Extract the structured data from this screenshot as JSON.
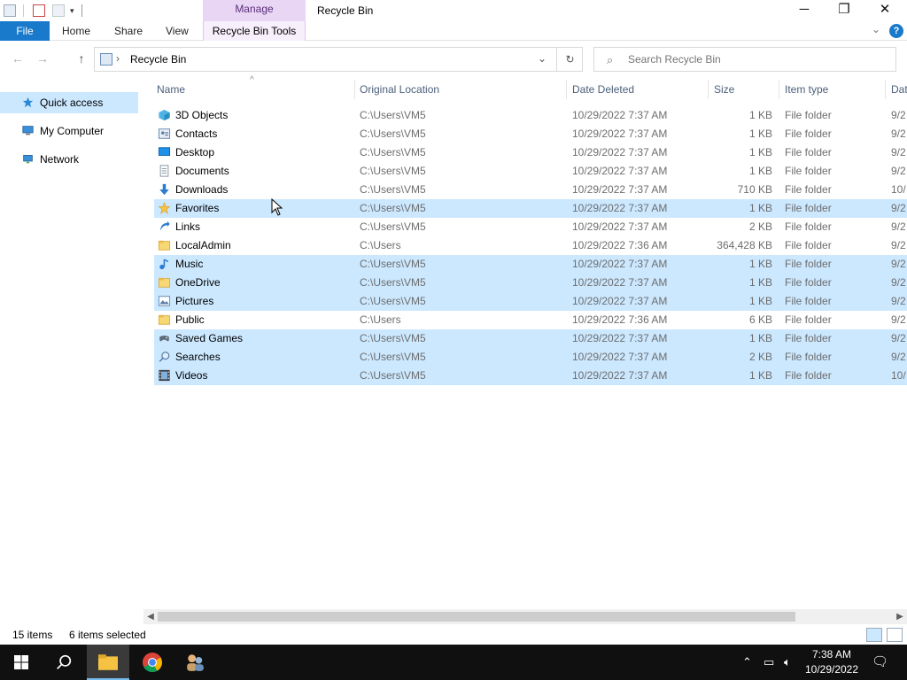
{
  "window": {
    "title": "Recycle Bin",
    "context_tab": "Manage",
    "minimize_glyph": "─",
    "maximize_glyph": "❐",
    "close_glyph": "✕"
  },
  "ribbon": {
    "file": "File",
    "tabs": [
      "Home",
      "Share",
      "View"
    ],
    "context_tab_label": "Recycle Bin Tools"
  },
  "address": {
    "path": "Recycle Bin",
    "search_placeholder": "Search Recycle Bin"
  },
  "nav": {
    "items": [
      {
        "label": "Quick access",
        "icon": "star-icon",
        "selected": true
      },
      {
        "label": "My Computer",
        "icon": "computer-icon",
        "selected": false
      },
      {
        "label": "Network",
        "icon": "network-icon",
        "selected": false
      }
    ]
  },
  "columns": [
    "Name",
    "Original Location",
    "Date Deleted",
    "Size",
    "Item type",
    "Dat"
  ],
  "rows": [
    {
      "name": "3D Objects",
      "location": "C:\\Users\\VM5",
      "date": "10/29/2022 7:37 AM",
      "size": "1 KB",
      "type": "File folder",
      "more": "9/2",
      "selected": false,
      "icon": "cube-icon"
    },
    {
      "name": "Contacts",
      "location": "C:\\Users\\VM5",
      "date": "10/29/2022 7:37 AM",
      "size": "1 KB",
      "type": "File folder",
      "more": "9/2",
      "selected": false,
      "icon": "contacts-icon"
    },
    {
      "name": "Desktop",
      "location": "C:\\Users\\VM5",
      "date": "10/29/2022 7:37 AM",
      "size": "1 KB",
      "type": "File folder",
      "more": "9/2",
      "selected": false,
      "icon": "desktop-icon"
    },
    {
      "name": "Documents",
      "location": "C:\\Users\\VM5",
      "date": "10/29/2022 7:37 AM",
      "size": "1 KB",
      "type": "File folder",
      "more": "9/2",
      "selected": false,
      "icon": "document-icon"
    },
    {
      "name": "Downloads",
      "location": "C:\\Users\\VM5",
      "date": "10/29/2022 7:37 AM",
      "size": "710 KB",
      "type": "File folder",
      "more": "10/",
      "selected": false,
      "icon": "download-icon"
    },
    {
      "name": "Favorites",
      "location": "C:\\Users\\VM5",
      "date": "10/29/2022 7:37 AM",
      "size": "1 KB",
      "type": "File folder",
      "more": "9/2",
      "selected": true,
      "icon": "star-icon"
    },
    {
      "name": "Links",
      "location": "C:\\Users\\VM5",
      "date": "10/29/2022 7:37 AM",
      "size": "2 KB",
      "type": "File folder",
      "more": "9/2",
      "selected": false,
      "icon": "link-icon"
    },
    {
      "name": "LocalAdmin",
      "location": "C:\\Users",
      "date": "10/29/2022 7:36 AM",
      "size": "364,428 KB",
      "type": "File folder",
      "more": "9/2",
      "selected": false,
      "icon": "folder-icon"
    },
    {
      "name": "Music",
      "location": "C:\\Users\\VM5",
      "date": "10/29/2022 7:37 AM",
      "size": "1 KB",
      "type": "File folder",
      "more": "9/2",
      "selected": true,
      "icon": "music-icon"
    },
    {
      "name": "OneDrive",
      "location": "C:\\Users\\VM5",
      "date": "10/29/2022 7:37 AM",
      "size": "1 KB",
      "type": "File folder",
      "more": "9/2",
      "selected": true,
      "icon": "folder-icon"
    },
    {
      "name": "Pictures",
      "location": "C:\\Users\\VM5",
      "date": "10/29/2022 7:37 AM",
      "size": "1 KB",
      "type": "File folder",
      "more": "9/2",
      "selected": true,
      "icon": "picture-icon"
    },
    {
      "name": "Public",
      "location": "C:\\Users",
      "date": "10/29/2022 7:36 AM",
      "size": "6 KB",
      "type": "File folder",
      "more": "9/2",
      "selected": false,
      "icon": "folder-icon"
    },
    {
      "name": "Saved Games",
      "location": "C:\\Users\\VM5",
      "date": "10/29/2022 7:37 AM",
      "size": "1 KB",
      "type": "File folder",
      "more": "9/2",
      "selected": true,
      "icon": "gamepad-icon"
    },
    {
      "name": "Searches",
      "location": "C:\\Users\\VM5",
      "date": "10/29/2022 7:37 AM",
      "size": "2 KB",
      "type": "File folder",
      "more": "9/2",
      "selected": true,
      "icon": "search-icon"
    },
    {
      "name": "Videos",
      "location": "C:\\Users\\VM5",
      "date": "10/29/2022 7:37 AM",
      "size": "1 KB",
      "type": "File folder",
      "more": "10/",
      "selected": true,
      "icon": "film-icon"
    }
  ],
  "status": {
    "count": "15 items",
    "selected": "6 items selected"
  },
  "taskbar": {
    "time": "7:38 AM",
    "date": "10/29/2022"
  },
  "colors": {
    "selection": "#cce8ff",
    "accent": "#1979ca",
    "context_tab": "#e9d6f5",
    "taskbar": "#101010"
  }
}
